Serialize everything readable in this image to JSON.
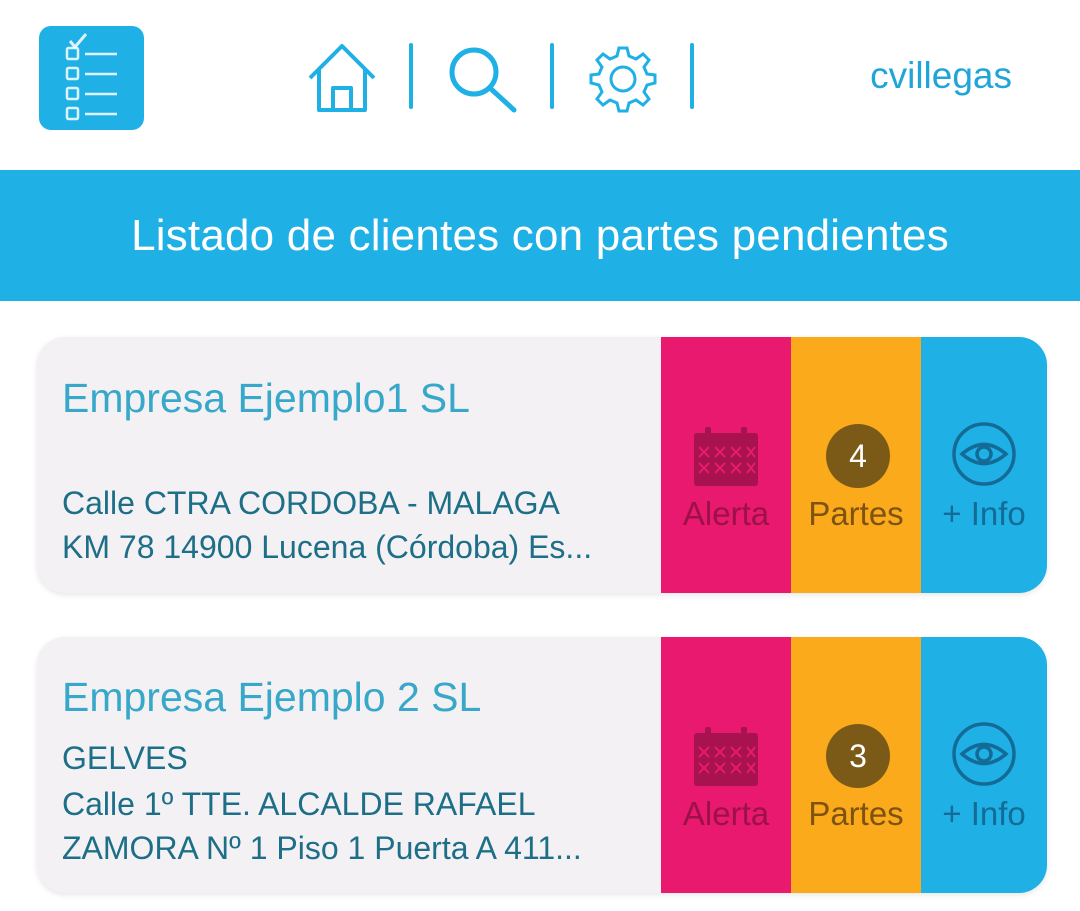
{
  "header": {
    "app_icon": "checklist-icon",
    "nav": [
      {
        "name": "home",
        "icon": "home-icon"
      },
      {
        "name": "search",
        "icon": "search-icon"
      },
      {
        "name": "settings",
        "icon": "gear-icon"
      }
    ],
    "username": "cvillegas"
  },
  "banner": {
    "title": "Listado de clientes con partes pendientes"
  },
  "clients": [
    {
      "name": "Empresa Ejemplo1 SL",
      "address_lines": [
        "Calle CTRA CORDOBA - MALAGA",
        "KM 78 14900 Lucena (Córdoba) Es..."
      ],
      "alert_label": "Alerta",
      "partes_count": "4",
      "partes_label": "Partes",
      "info_label": "+ Info"
    },
    {
      "name": "Empresa Ejemplo 2 SL",
      "address_lines": [
        "GELVES",
        "Calle 1º TTE. ALCALDE RAFAEL",
        "ZAMORA Nº 1 Piso 1 Puerta A 411..."
      ],
      "alert_label": "Alerta",
      "partes_count": "3",
      "partes_label": "Partes",
      "info_label": "+ Info"
    }
  ],
  "colors": {
    "primary": "#1fb0e6",
    "alert": "#e8196e",
    "partes": "#fbaa1b",
    "badge": "#7a5a16",
    "card_bg": "#f4f1f4"
  }
}
